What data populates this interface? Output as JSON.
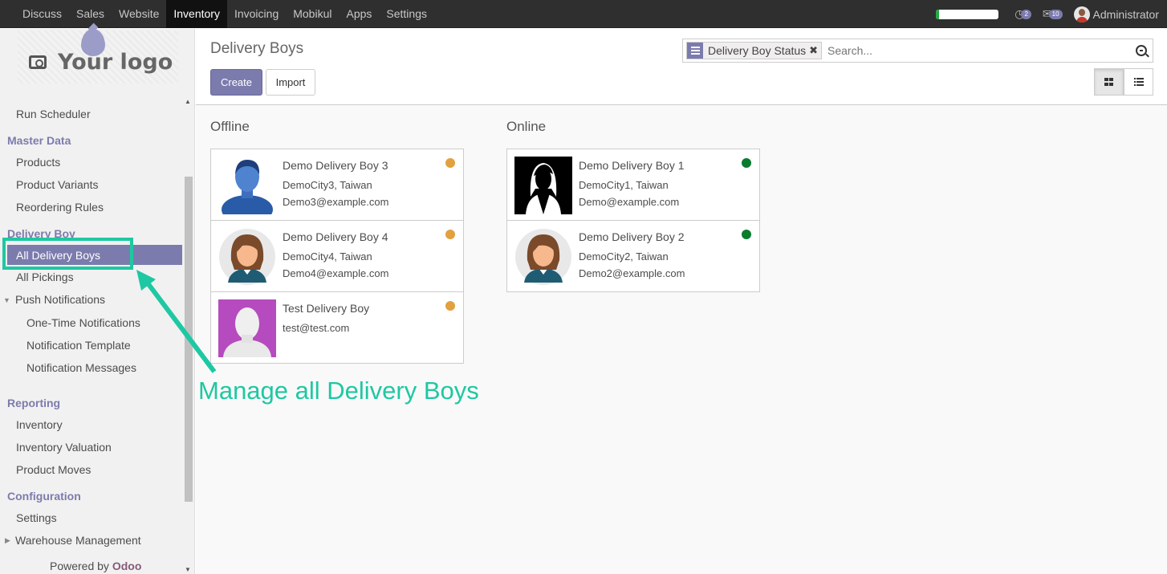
{
  "topbar": {
    "menu": [
      "Discuss",
      "Sales",
      "Website",
      "Inventory",
      "Invoicing",
      "Mobikul",
      "Apps",
      "Settings"
    ],
    "active_index": 3,
    "progress_fraction": 0.05,
    "activity_count": "2",
    "message_count": "10",
    "user_name": "Administrator"
  },
  "sidebar": {
    "logo_text": "Your logo",
    "run_scheduler": "Run Scheduler",
    "master_data": "Master Data",
    "products": "Products",
    "product_variants": "Product Variants",
    "reordering_rules": "Reordering Rules",
    "delivery_boy": "Delivery Boy",
    "all_delivery_boys": "All Delivery Boys",
    "all_pickings": "All Pickings",
    "push_notifications": "Push Notifications",
    "one_time_notifications": "One-Time Notifications",
    "notification_template": "Notification Template",
    "notification_messages": "Notification Messages",
    "reporting": "Reporting",
    "inventory": "Inventory",
    "inventory_valuation": "Inventory Valuation",
    "product_moves": "Product Moves",
    "configuration": "Configuration",
    "settings": "Settings",
    "warehouse_management": "Warehouse Management",
    "powered_by": "Powered by",
    "odoo": "Odoo"
  },
  "control_panel": {
    "title": "Delivery Boys",
    "create_label": "Create",
    "import_label": "Import",
    "facet_label": "Delivery Boy Status",
    "search_placeholder": "Search..."
  },
  "colors": {
    "accent": "#7c7bad",
    "offline": "#e2a03f",
    "online": "#0b7b2e",
    "annotation": "#1ec8a2"
  },
  "kanban": {
    "offline_title": "Offline",
    "online_title": "Online",
    "offline": [
      {
        "name": "Demo Delivery Boy 3",
        "line1": "DemoCity3, Taiwan",
        "line2": "Demo3@example.com",
        "photo": "blue-man-avatar"
      },
      {
        "name": "Demo Delivery Boy 4",
        "line1": "DemoCity4, Taiwan",
        "line2": "Demo4@example.com",
        "photo": "woman-avatar"
      },
      {
        "name": "Test Delivery Boy",
        "line1": "test@test.com",
        "line2": "",
        "photo": "placeholder-avatar"
      }
    ],
    "online": [
      {
        "name": "Demo Delivery Boy 1",
        "line1": "DemoCity1, Taiwan",
        "line2": "Demo@example.com",
        "photo": "silhouette-avatar"
      },
      {
        "name": "Demo Delivery Boy 2",
        "line1": "DemoCity2, Taiwan",
        "line2": "Demo2@example.com",
        "photo": "woman-avatar"
      }
    ]
  },
  "annotation": {
    "callout": "Manage all Delivery Boys"
  }
}
